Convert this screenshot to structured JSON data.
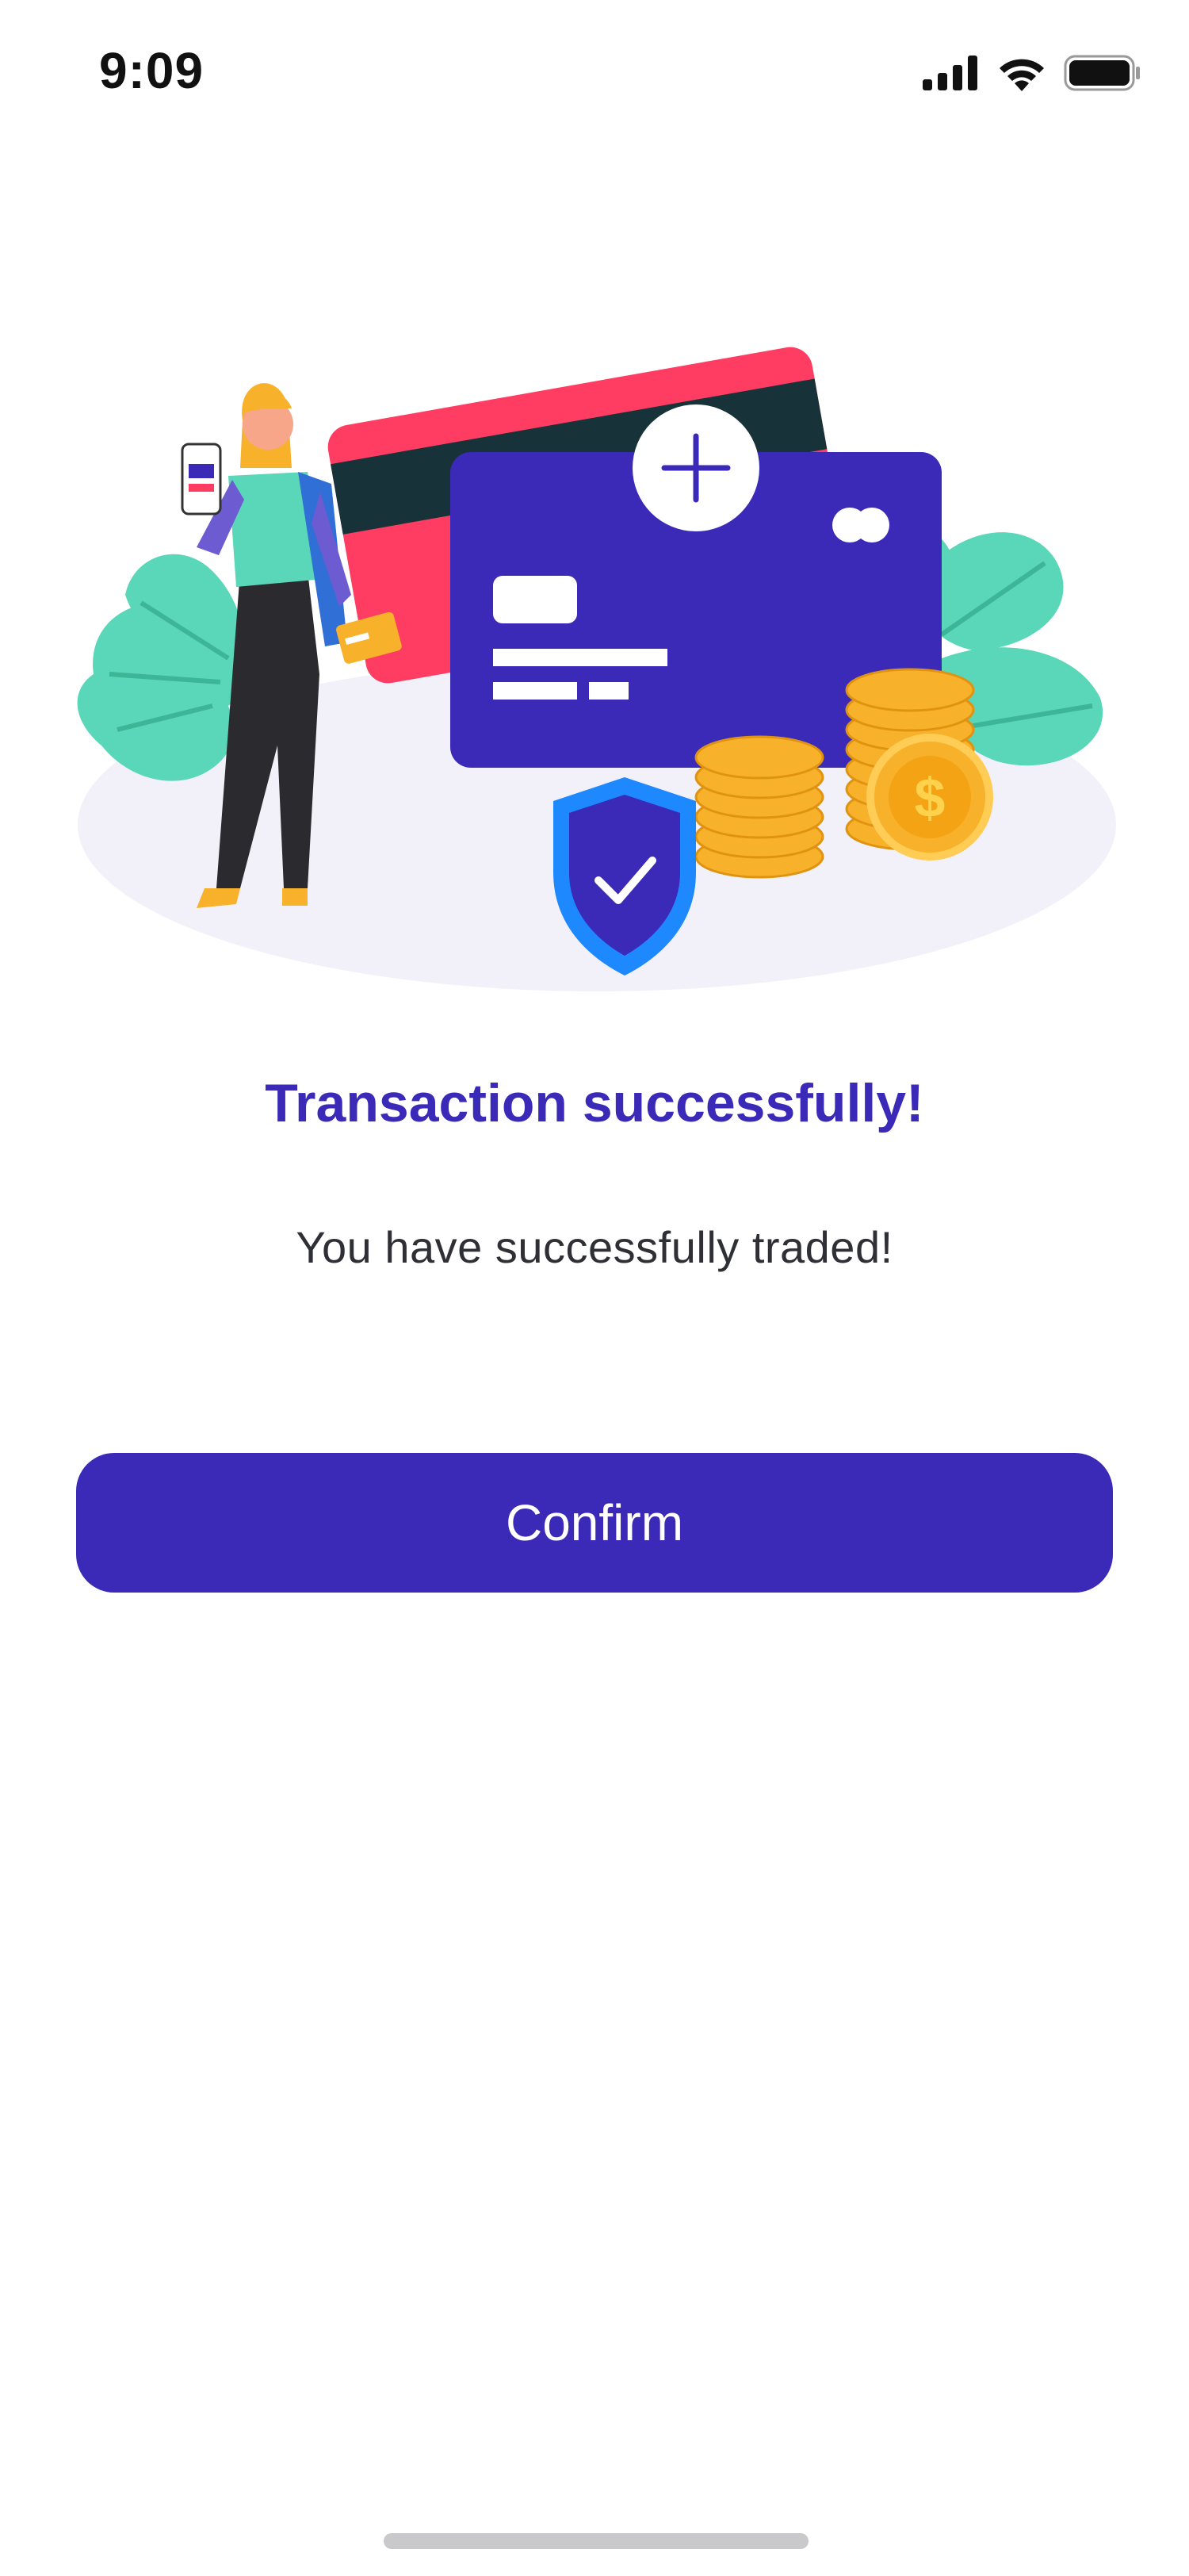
{
  "status_bar": {
    "time": "9:09",
    "icons": [
      "signal-icon",
      "wifi-icon",
      "battery-icon"
    ]
  },
  "illustration": {
    "description_icons": [
      "person-icon",
      "credit-card-icon",
      "shield-check-icon",
      "coins-icon",
      "plant-icon"
    ]
  },
  "main": {
    "title": "Transaction successfully!",
    "subtitle": "You have successfully traded!"
  },
  "actions": {
    "confirm_label": "Confirm"
  },
  "colors": {
    "primary": "#3a2ab7",
    "card_red": "#ff3d63",
    "card_dark": "#173239",
    "leaf": "#5ad6b8",
    "coin": "#f8b12a",
    "shield": "#1e88ff"
  }
}
